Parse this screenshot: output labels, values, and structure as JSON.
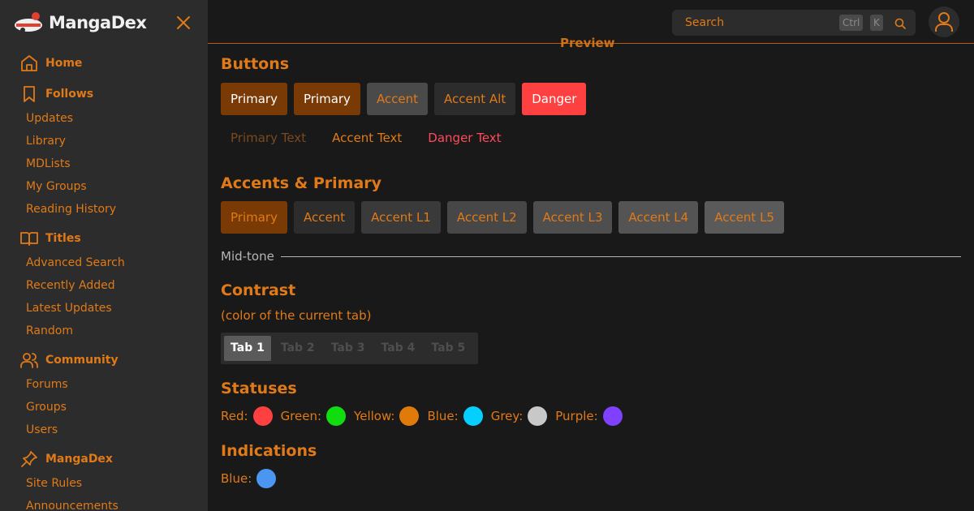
{
  "brand": {
    "name": "MangaDex"
  },
  "sidebar": {
    "sections": [
      {
        "label": "Home",
        "icon": "home-icon",
        "items": []
      },
      {
        "label": "Follows",
        "icon": "bookmark-icon",
        "items": [
          "Updates",
          "Library",
          "MDLists",
          "My Groups",
          "Reading History"
        ]
      },
      {
        "label": "Titles",
        "icon": "book-open-icon",
        "items": [
          "Advanced Search",
          "Recently Added",
          "Latest Updates",
          "Random"
        ]
      },
      {
        "label": "Community",
        "icon": "users-icon",
        "items": [
          "Forums",
          "Groups",
          "Users"
        ]
      },
      {
        "label": "MangaDex",
        "icon": "pin-icon",
        "items": [
          "Site Rules",
          "Announcements"
        ]
      }
    ]
  },
  "topbar": {
    "search_placeholder": "Search",
    "shortcut_ctrl": "Ctrl",
    "shortcut_key": "K",
    "preview_label": "Preview"
  },
  "sections": {
    "buttons": {
      "title": "Buttons",
      "solid": [
        {
          "label": "Primary",
          "bg": "#7a3a06",
          "fg": "#ffffff"
        },
        {
          "label": "Primary",
          "bg": "#7a3a06",
          "fg": "#ffffff"
        },
        {
          "label": "Accent",
          "bg": "#4a4a4a",
          "fg": "#e07a18"
        },
        {
          "label": "Accent Alt",
          "bg": "#2c2c2c",
          "fg": "#e07a18"
        },
        {
          "label": "Danger",
          "bg": "#ff4040",
          "fg": "#ffffff"
        }
      ],
      "text": [
        {
          "label": "Primary Text",
          "fg": "#7a4a1e"
        },
        {
          "label": "Accent Text",
          "fg": "#e07a18"
        },
        {
          "label": "Danger Text",
          "fg": "#ff4a5a"
        }
      ]
    },
    "accents": {
      "title": "Accents & Primary",
      "items": [
        {
          "label": "Primary",
          "bg": "#7a3a06"
        },
        {
          "label": "Accent",
          "bg": "#2c2c2c"
        },
        {
          "label": "Accent L1",
          "bg": "#3a3a3a"
        },
        {
          "label": "Accent L2",
          "bg": "#474747"
        },
        {
          "label": "Accent L3",
          "bg": "#4e4e4e"
        },
        {
          "label": "Accent L4",
          "bg": "#545454"
        },
        {
          "label": "Accent L5",
          "bg": "#5a5a5a"
        }
      ]
    },
    "midtone": {
      "label": "Mid-tone"
    },
    "contrast": {
      "title": "Contrast",
      "subtitle": "(color of the current tab)",
      "tabs": [
        "Tab 1",
        "Tab 2",
        "Tab 3",
        "Tab 4",
        "Tab 5"
      ],
      "active_tab": 0
    },
    "statuses": {
      "title": "Statuses",
      "items": [
        {
          "label": "Red:",
          "color": "#ff4040"
        },
        {
          "label": "Green:",
          "color": "#10dc10"
        },
        {
          "label": "Yellow:",
          "color": "#e07a0a"
        },
        {
          "label": "Blue:",
          "color": "#04cfff"
        },
        {
          "label": "Grey:",
          "color": "#c8c8c8"
        },
        {
          "label": "Purple:",
          "color": "#8040ff"
        }
      ]
    },
    "indications": {
      "title": "Indications",
      "items": [
        {
          "label": "Blue:",
          "color": "#4a96f0"
        }
      ]
    }
  },
  "colors": {
    "accent": "#e07a18",
    "background": "#191919",
    "sidebar": "#2c2c2c"
  }
}
